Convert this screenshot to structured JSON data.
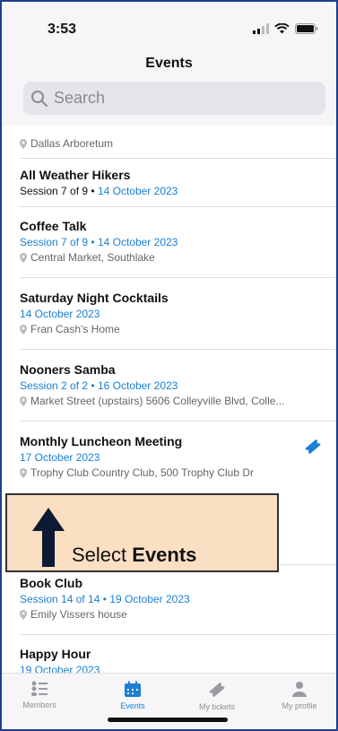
{
  "status": {
    "time": "3:53"
  },
  "header": {
    "title": "Events"
  },
  "search": {
    "placeholder": "Search"
  },
  "events": [
    {
      "title": "",
      "meta_session": "",
      "meta_date": "",
      "location": "Dallas Arboretum"
    },
    {
      "title": "All Weather Hikers",
      "meta_session": "Session 7 of 9 •",
      "meta_date": "14 October 2023",
      "location": ""
    },
    {
      "title": "Coffee Talk",
      "meta_session": "Session 7 of 9 •",
      "meta_date": "14 October 2023",
      "location": "Central Market, Southlake"
    },
    {
      "title": "Saturday Night Cocktails",
      "meta_session": "",
      "meta_date": "14 October 2023",
      "location": "Fran Cash's Home"
    },
    {
      "title": "Nooners Samba",
      "meta_session": "Session 2 of 2 •",
      "meta_date": "16 October 2023",
      "location": "Market Street (upstairs) 5606 Colleyville Blvd, Colle..."
    },
    {
      "title": "Monthly Luncheon Meeting",
      "meta_session": "",
      "meta_date": "17 October 2023",
      "location": "Trophy Club Country Club, 500 Trophy Club Dr"
    },
    {
      "title": "Book Club",
      "meta_session": "Session 14 of 14 •",
      "meta_date": "19 October 2023",
      "location": "Emily Vissers house"
    },
    {
      "title": "Happy Hour",
      "meta_session": "",
      "meta_date": "19 October 2023",
      "location": ""
    }
  ],
  "tabs": [
    {
      "label": "Members",
      "icon": "members-icon"
    },
    {
      "label": "Events",
      "icon": "calendar-icon"
    },
    {
      "label": "My tickets",
      "icon": "ticket-icon"
    },
    {
      "label": "My profile",
      "icon": "person-icon"
    }
  ],
  "callout": {
    "prefix": "Select ",
    "bold": "Events"
  },
  "colors": {
    "accent": "#1b7fd6",
    "callout_bg": "#fbdfc3",
    "frame": "#1f3f8f"
  }
}
